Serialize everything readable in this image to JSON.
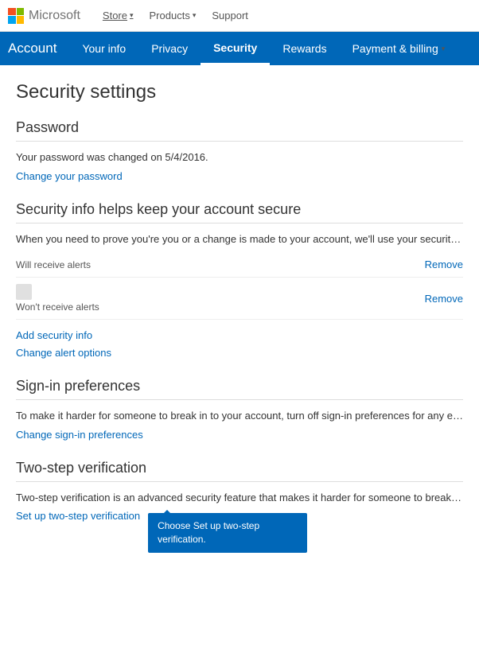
{
  "top_nav": {
    "brand": "Microsoft",
    "links": [
      {
        "label": "Store",
        "has_chevron": true,
        "underline": true
      },
      {
        "label": "Products",
        "has_chevron": true
      },
      {
        "label": "Support",
        "has_chevron": false
      }
    ]
  },
  "account_nav": {
    "brand_label": "Account",
    "items": [
      {
        "label": "Your info",
        "active": false
      },
      {
        "label": "Privacy",
        "active": false
      },
      {
        "label": "Security",
        "active": true
      },
      {
        "label": "Rewards",
        "active": false
      },
      {
        "label": "Payment & billing",
        "active": false,
        "has_chevron": true
      }
    ]
  },
  "page": {
    "title": "Security settings",
    "sections": {
      "password": {
        "title": "Password",
        "info_text": "Your password was changed on 5/4/2016.",
        "change_link": "Change your password"
      },
      "security_info": {
        "title": "Security info helps keep your account secure",
        "description": "When you need to prove you're you or a change is made to your account, we'll use your security info to co",
        "rows": [
          {
            "label": "Will receive alerts",
            "remove_label": "Remove"
          },
          {
            "label": "Won't receive alerts",
            "remove_label": "Remove"
          }
        ],
        "add_link": "Add security info",
        "alert_link": "Change alert options"
      },
      "signin_prefs": {
        "title": "Sign-in preferences",
        "description": "To make it harder for someone to break in to your account, turn off sign-in preferences for any email addre",
        "change_link": "Change sign-in preferences"
      },
      "two_step": {
        "title": "Two-step verification",
        "description": "Two-step verification is an advanced security feature that makes it harder for someone to break in to your a",
        "setup_link": "Set up two-step verification",
        "tooltip": "Choose Set up two-step verification."
      }
    }
  }
}
